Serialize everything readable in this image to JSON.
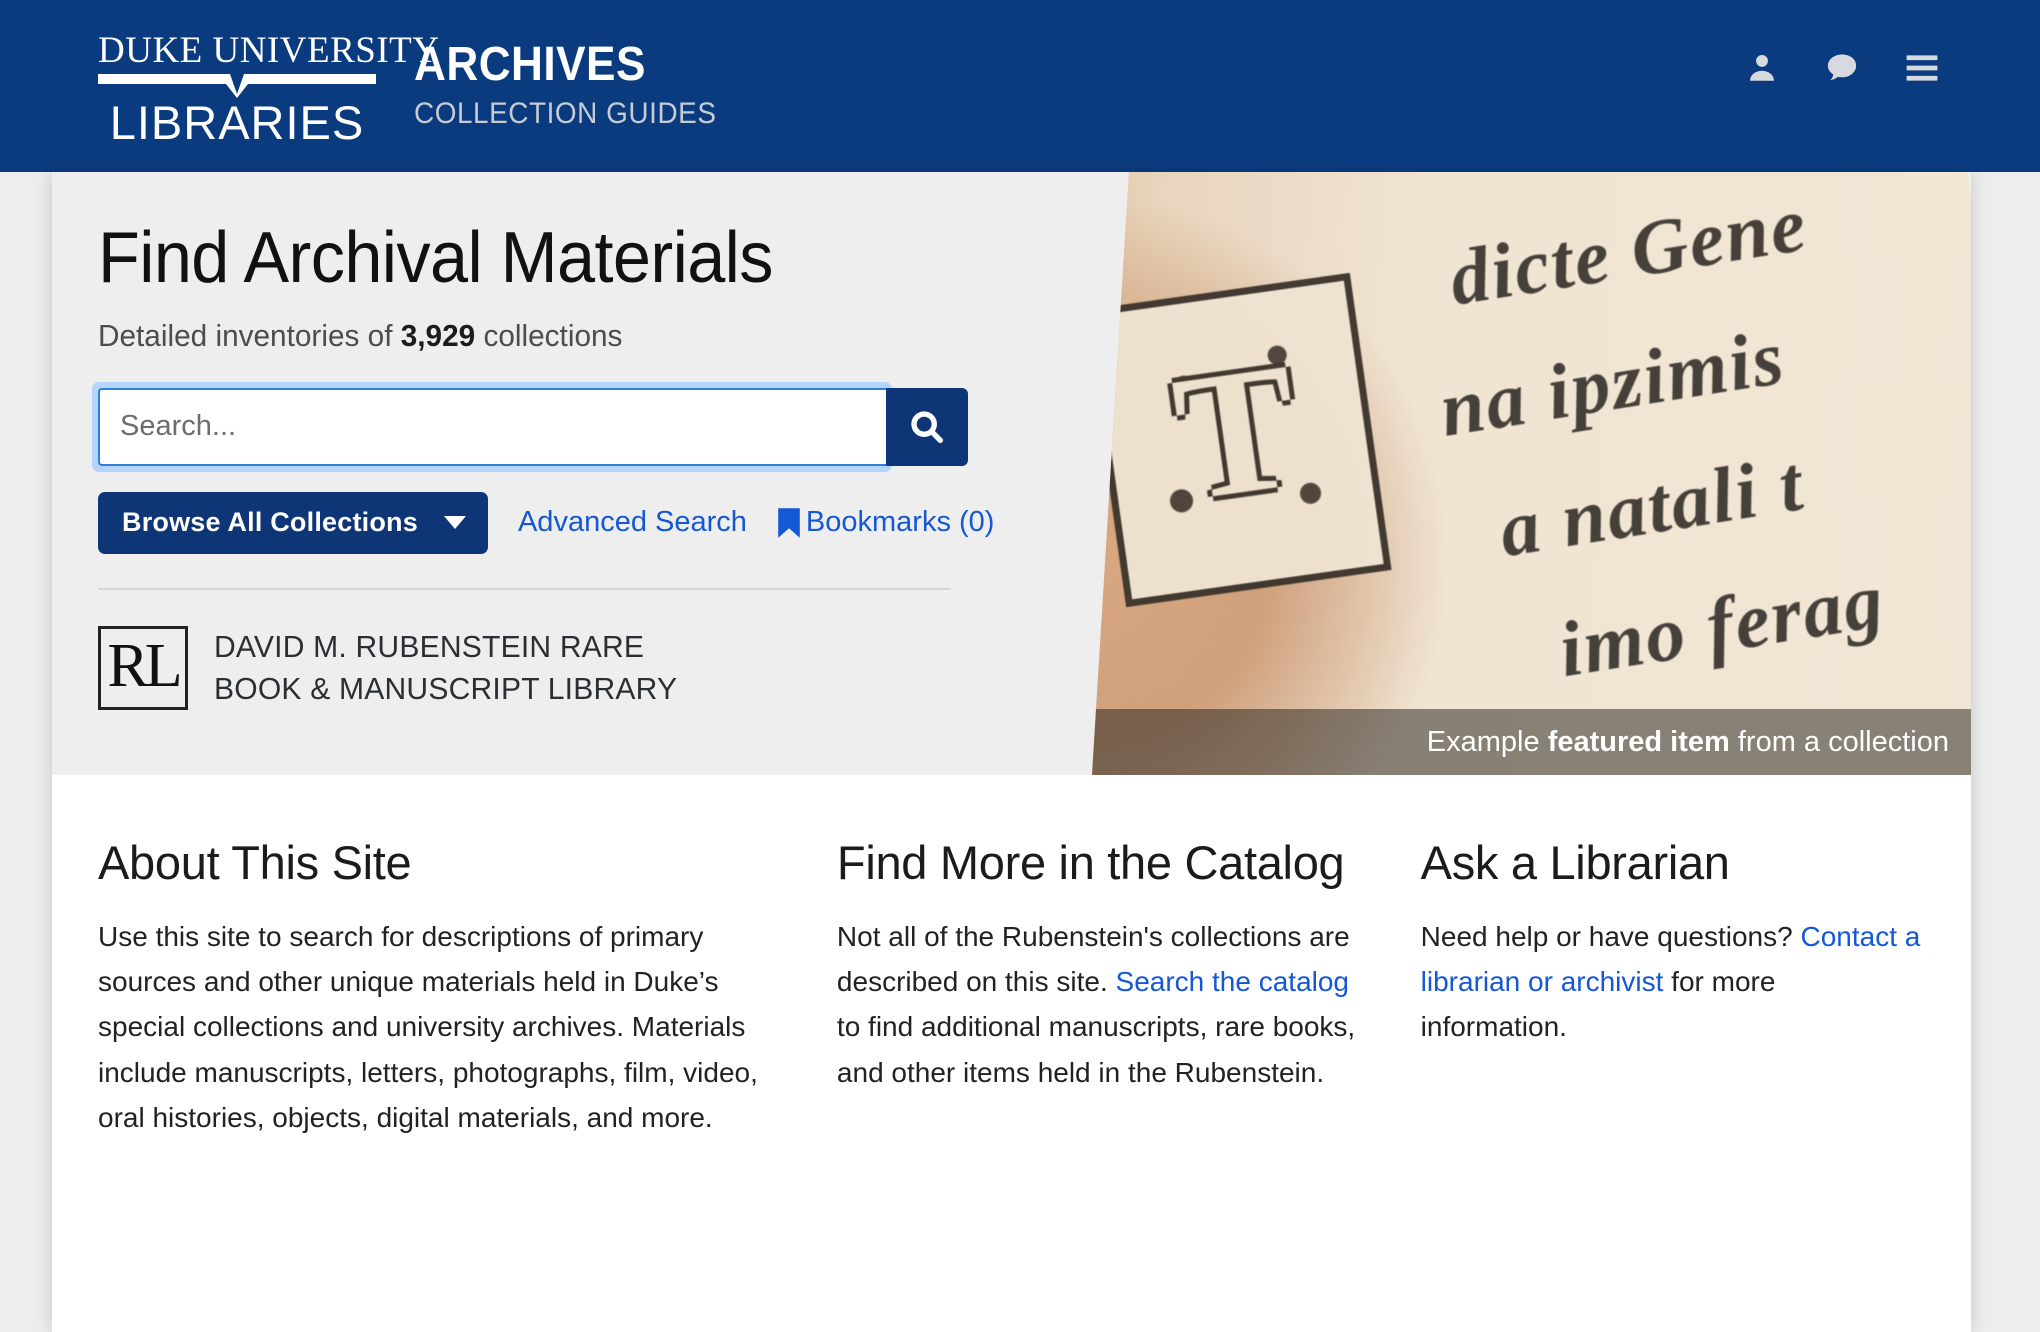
{
  "header": {
    "duke_top": "DUKE UNIVERSITY",
    "duke_bottom": "LIBRARIES",
    "archives_title": "ARCHIVES",
    "archives_subtitle": "COLLECTION GUIDES",
    "icons": [
      {
        "name": "user-icon",
        "label": "Account"
      },
      {
        "name": "chat-icon",
        "label": "Chat"
      },
      {
        "name": "hamburger-menu-icon",
        "label": "Menu"
      }
    ],
    "background_color": "#0b3b7f"
  },
  "hero": {
    "title": "Find Archival Materials",
    "subtitle_prefix": "Detailed inventories of ",
    "collection_count": "3,929",
    "subtitle_suffix": " collections",
    "search": {
      "placeholder": "Search...",
      "value": "",
      "button_icon": "search-icon"
    },
    "browse_button": "Browse All Collections",
    "advanced_search": "Advanced Search",
    "bookmarks": "Bookmarks (0)",
    "library": {
      "monogram": "RL",
      "line1": "DAVID M. RUBENSTEIN RARE",
      "line2": "BOOK & MANUSCRIPT LIBRARY"
    },
    "image": {
      "caption_prefix": "Example ",
      "caption_bold": "featured item",
      "caption_suffix": " from a collection",
      "manuscript_lines": [
        "dicte Gene",
        "na ipzimis",
        "a natali t",
        "imo ferag"
      ],
      "initial_letter": "T"
    },
    "accent_color": "#0e3575",
    "link_color": "#1458d6"
  },
  "content": {
    "columns": [
      {
        "heading": "About This Site",
        "body": "Use this site to search for descriptions of primary sources and other unique materials held in Duke’s special collections and university archives. Materials include manuscripts, letters, photographs, film, video, oral histories, objects, digital materials, and more."
      },
      {
        "heading": "Find More in the Catalog",
        "body_before": "Not all of the Rubenstein's collections are described on this site. ",
        "link": "Search the catalog",
        "body_after": " to find additional manuscripts, rare books, and other items held in the Rubenstein."
      },
      {
        "heading": "Ask a Librarian",
        "body_before": "Need help or have questions? ",
        "link": "Contact a librarian or archivist",
        "body_after": " for more information."
      }
    ]
  }
}
